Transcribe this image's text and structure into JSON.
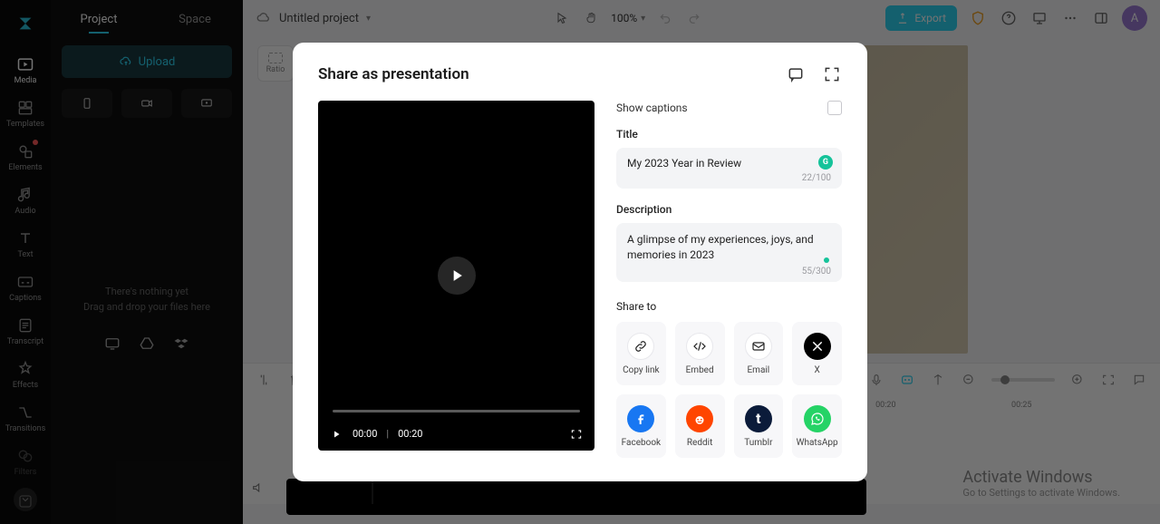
{
  "leftPanel": {
    "tabs": {
      "project": "Project",
      "space": "Space"
    },
    "uploadLabel": "Upload",
    "dropTitle": "There's nothing yet",
    "dropSubtitle": "Drag and drop your files here"
  },
  "rail": {
    "items": [
      {
        "label": "Media"
      },
      {
        "label": "Templates"
      },
      {
        "label": "Elements"
      },
      {
        "label": "Audio"
      },
      {
        "label": "Text"
      },
      {
        "label": "Captions"
      },
      {
        "label": "Transcript"
      },
      {
        "label": "Effects"
      },
      {
        "label": "Transitions"
      },
      {
        "label": "Filters"
      }
    ]
  },
  "topbar": {
    "projectTitle": "Untitled project",
    "zoom": "100%",
    "exportLabel": "Export",
    "avatarInitial": "A"
  },
  "ratio": {
    "label": "Ratio"
  },
  "timeline": {
    "ticks": [
      "00:20",
      "00:25"
    ]
  },
  "modal": {
    "title": "Share as presentation",
    "showCaptions": "Show captions",
    "titleLabel": "Title",
    "titleValue": "My 2023 Year in Review",
    "titleCount": "22/100",
    "descLabel": "Description",
    "descValue": "A glimpse of my experiences, joys, and memories in 2023",
    "descCount": "55/300",
    "shareToLabel": "Share to",
    "preview": {
      "current": "00:00",
      "duration": "00:20"
    },
    "grammarlyBadge": "G",
    "share": {
      "copy": "Copy link",
      "embed": "Embed",
      "email": "Email",
      "x": "X",
      "facebook": "Facebook",
      "reddit": "Reddit",
      "tumblr": "Tumblr",
      "whatsapp": "WhatsApp"
    }
  },
  "watermark": {
    "title": "Activate Windows",
    "subtitle": "Go to Settings to activate Windows."
  }
}
